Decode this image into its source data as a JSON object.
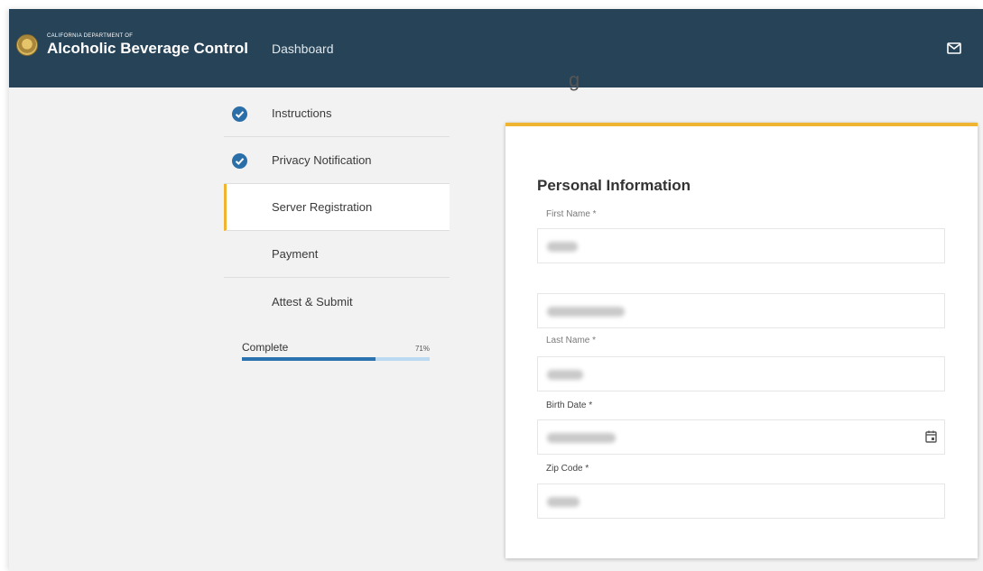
{
  "header": {
    "org_small": "CALIFORNIA DEPARTMENT OF",
    "org_name": "Alcoholic Beverage Control",
    "nav_link": "Dashboard",
    "mail_icon": "mail-icon",
    "background": "#274357"
  },
  "page": {
    "partial_heading": "g"
  },
  "steps": [
    {
      "label": "Instructions",
      "status": "complete"
    },
    {
      "label": "Privacy Notification",
      "status": "complete"
    },
    {
      "label": "Server Registration",
      "status": "active"
    },
    {
      "label": "Payment",
      "status": "pending"
    },
    {
      "label": "Attest & Submit",
      "status": "pending"
    }
  ],
  "progress": {
    "label": "Complete",
    "percent_text": "71%",
    "value": 0.71
  },
  "form": {
    "title": "Personal Information",
    "first_name_label": "First Name *",
    "last_name_label": "Last Name *",
    "birth_date_label": "Birth Date *",
    "zip_label": "Zip Code *",
    "values_redacted": true
  },
  "colors": {
    "accent": "#f0b433",
    "check": "#2a6fa8",
    "progress_fill": "#2a72b0",
    "progress_track": "#bcd9f2"
  }
}
